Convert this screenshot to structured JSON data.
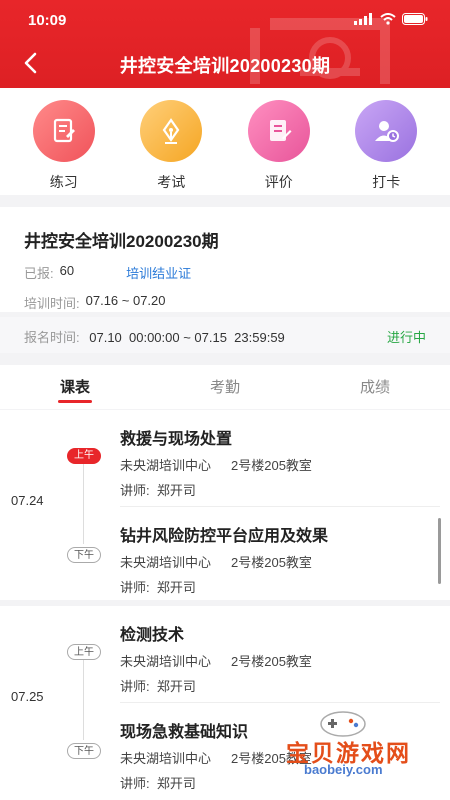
{
  "status_bar": {
    "time": "10:09"
  },
  "header": {
    "title": "井控安全培训20200230期"
  },
  "actions": [
    {
      "label": "练习",
      "icon": "practice-icon"
    },
    {
      "label": "考试",
      "icon": "pen-icon"
    },
    {
      "label": "评价",
      "icon": "evaluate-icon"
    },
    {
      "label": "打卡",
      "icon": "checkin-icon"
    }
  ],
  "training": {
    "name": "井控安全培训20200230期",
    "enrolled_label": "已报:",
    "enrolled_value": "60",
    "cert_link": "培训结业证",
    "time_label": "培训时间:",
    "time_value": "07.16 ~ 07.20"
  },
  "signup": {
    "label": "报名时间:",
    "value": "07.10  00:00:00 ~ 07.15  23:59:59",
    "status": "进行中"
  },
  "tabs": [
    {
      "label": "课表",
      "active": true
    },
    {
      "label": "考勤",
      "active": false
    },
    {
      "label": "成绩",
      "active": false
    }
  ],
  "schedule": [
    {
      "date": "07.24",
      "lessons": [
        {
          "period": "上午",
          "title": "救援与现场处置",
          "place": "未央湖培训中心",
          "room": "2号楼205教室",
          "teacher": "讲师:  郑开司"
        },
        {
          "period": "下午",
          "title": "钻井风险防控平台应用及效果",
          "place": "未央湖培训中心",
          "room": "2号楼205教室",
          "teacher": "讲师:  郑开司"
        }
      ]
    },
    {
      "date": "07.25",
      "lessons": [
        {
          "period": "上午",
          "title": "检测技术",
          "place": "未央湖培训中心",
          "room": "2号楼205教室",
          "teacher": "讲师:  郑开司"
        },
        {
          "period": "下午",
          "title": "现场急救基础知识",
          "place": "未央湖培训中心",
          "room": "2号楼205教室",
          "teacher": "讲师:  郑开司"
        }
      ]
    }
  ],
  "watermark": {
    "title": "宝贝游戏网",
    "url": "baobeiy.com"
  },
  "colors": {
    "brand_red": "#e8262a",
    "status_green": "#28a745",
    "link_blue": "#2a7ad8"
  }
}
